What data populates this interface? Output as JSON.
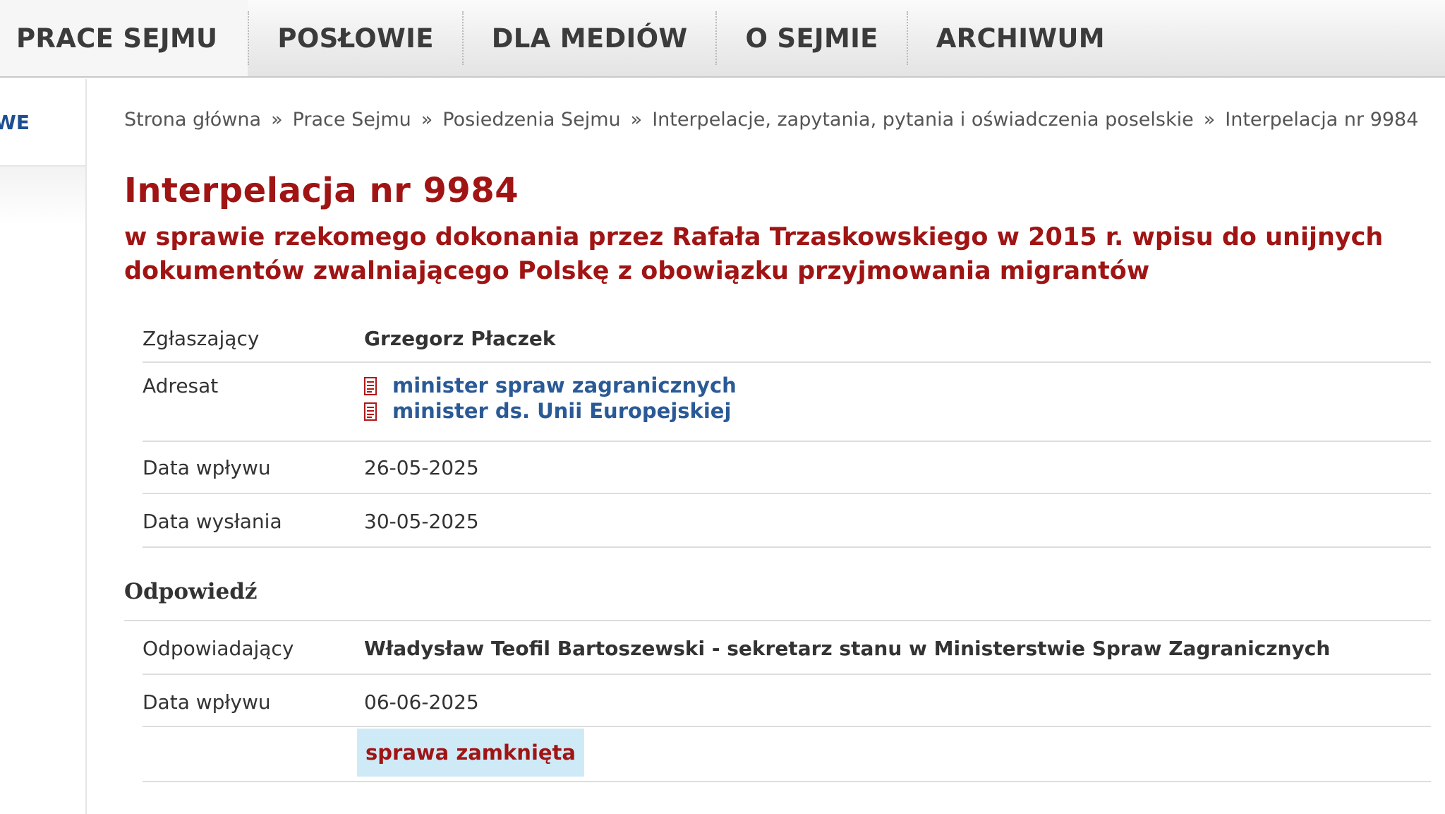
{
  "nav": {
    "items": [
      {
        "label": "PRACE SEJMU"
      },
      {
        "label": "POSŁOWIE"
      },
      {
        "label": "DLA MEDIÓW"
      },
      {
        "label": "O SEJMIE"
      },
      {
        "label": "ARCHIWUM"
      }
    ]
  },
  "sidebar": {
    "top_label": "WE"
  },
  "breadcrumb": {
    "items": [
      "Strona główna",
      "Prace Sejmu",
      "Posiedzenia Sejmu",
      "Interpelacje, zapytania, pytania i oświadczenia poselskie",
      "Interpelacja nr 9984"
    ],
    "separator": "»"
  },
  "title": "Interpelacja nr 9984",
  "subtitle": "w sprawie rzekomego dokonania przez Rafała Trzaskowskiego w 2015 r. wpisu do unijnych dokumentów zwalniającego Polskę z obowiązku przyjmowania migrantów",
  "details": {
    "zglaszajacy_label": "Zgłaszający",
    "zglaszajacy_value": "Grzegorz Płaczek",
    "adresat_label": "Adresat",
    "adresat_values": [
      "minister spraw zagranicznych",
      "minister ds. Unii Europejskiej"
    ],
    "data_wplywu_label": "Data wpływu",
    "data_wplywu_value": "26-05-2025",
    "data_wyslania_label": "Data wysłania",
    "data_wyslania_value": "30-05-2025"
  },
  "answer": {
    "heading": "Odpowiedź",
    "odpowiadajacy_label": "Odpowiadający",
    "odpowiadajacy_value": "Władysław Teofil Bartoszewski - sekretarz stanu w Ministerstwie Spraw Zagranicznych",
    "data_wplywu_label": "Data wpływu",
    "data_wplywu_value": "06-06-2025",
    "status": "sprawa zamknięta"
  },
  "colors": {
    "title_red": "#a01414",
    "link_blue": "#2a5a96",
    "badge_bg": "#cfeaf7"
  },
  "icons": {
    "document": "document-icon"
  }
}
